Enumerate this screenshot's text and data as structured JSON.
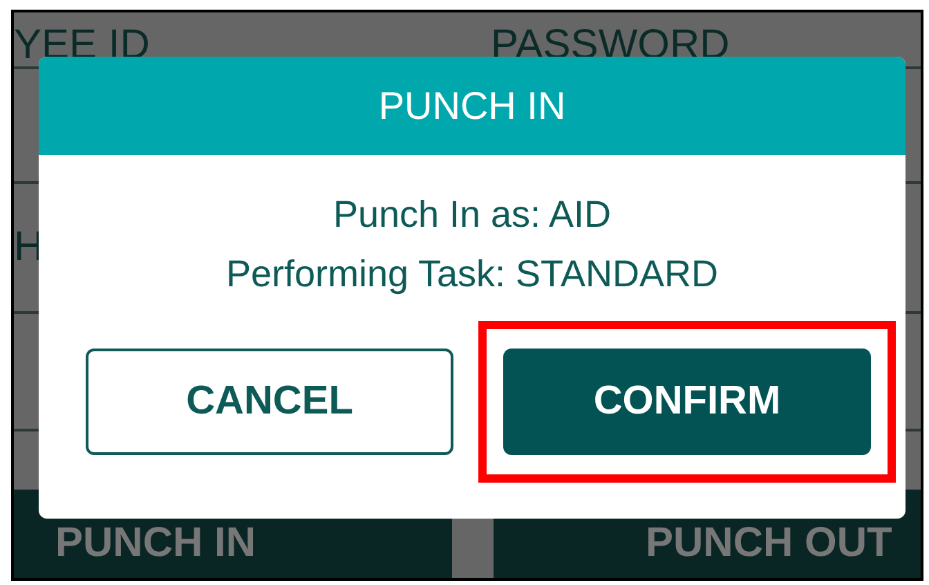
{
  "background": {
    "labels": [
      "YEE ID",
      "PASSWORD"
    ],
    "side_label": "H",
    "buttons": [
      "PUNCH IN",
      "PUNCH OUT"
    ]
  },
  "dialog": {
    "title": "PUNCH IN",
    "lines": [
      "Punch In as: AID",
      "Performing Task: STANDARD"
    ],
    "buttons": [
      {
        "label": "CANCEL",
        "kind": "outline",
        "highlighted": false
      },
      {
        "label": "CONFIRM",
        "kind": "filled",
        "highlighted": true
      }
    ]
  }
}
